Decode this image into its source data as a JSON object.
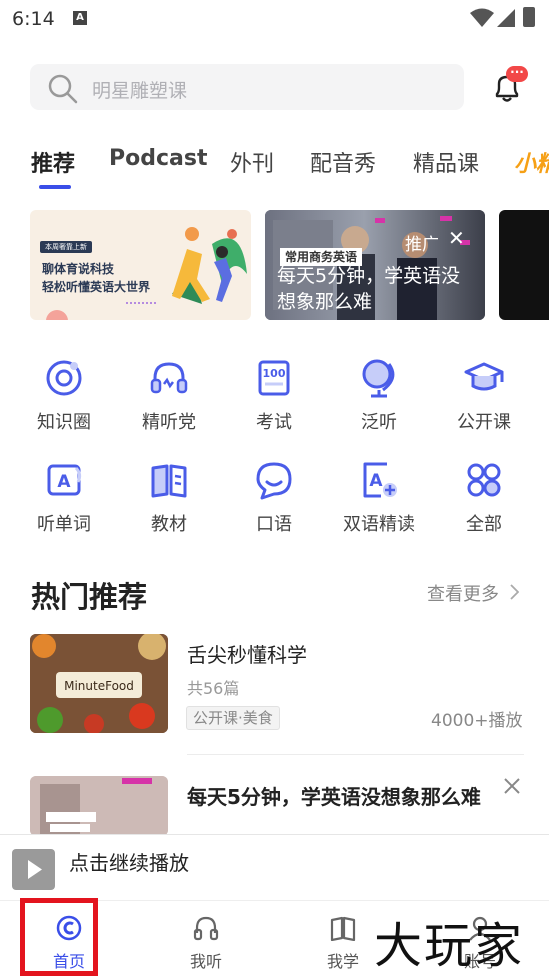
{
  "status_bar": {
    "time": "6:14",
    "notif_letter": "A"
  },
  "search": {
    "placeholder": "明星雕塑课",
    "badge": "···"
  },
  "tabs": [
    {
      "label": "推荐",
      "active": true
    },
    {
      "label": "Podcast"
    },
    {
      "label": "外刊"
    },
    {
      "label": "配音秀"
    },
    {
      "label": "精品课"
    },
    {
      "label": "小精"
    }
  ],
  "banners": {
    "first": {
      "tag": "本周奢靠上新",
      "line1": "聊体育说科技",
      "line2": "轻松听懂英语大世界"
    },
    "second": {
      "label": "常用商务英语",
      "title": "每天5分钟，学英语没想象那么难",
      "ad_tag": "推广"
    }
  },
  "grid": [
    {
      "label": "知识圈",
      "icon": "knowledge-circle-icon"
    },
    {
      "label": "精听党",
      "icon": "headset-icon"
    },
    {
      "label": "考试",
      "icon": "exam-100-icon"
    },
    {
      "label": "泛听",
      "icon": "globe-icon"
    },
    {
      "label": "公开课",
      "icon": "graduation-cap-icon"
    },
    {
      "label": "听单词",
      "icon": "word-card-icon"
    },
    {
      "label": "教材",
      "icon": "book-icon"
    },
    {
      "label": "口语",
      "icon": "speech-bubble-icon"
    },
    {
      "label": "双语精读",
      "icon": "bilingual-reading-icon"
    },
    {
      "label": "全部",
      "icon": "all-grid-icon"
    }
  ],
  "section": {
    "title": "热门推荐",
    "more": "查看更多",
    "items": [
      {
        "title": "舌尖秒懂科学",
        "count": "共56篇",
        "tag": "公开课·美食",
        "plays": "4000+播放",
        "thumb_text": "MinuteFood"
      },
      {
        "title": "每天5分钟，学英语没想象那么难"
      }
    ]
  },
  "continue_bar": {
    "text": "点击继续播放"
  },
  "bottom_nav": [
    {
      "label": "首页",
      "active": true
    },
    {
      "label": "我听"
    },
    {
      "label": "我学"
    },
    {
      "label": "账号"
    }
  ],
  "watermark": "大玩家",
  "colors": {
    "accent": "#3a4ee8",
    "highlight": "#e3141e"
  }
}
